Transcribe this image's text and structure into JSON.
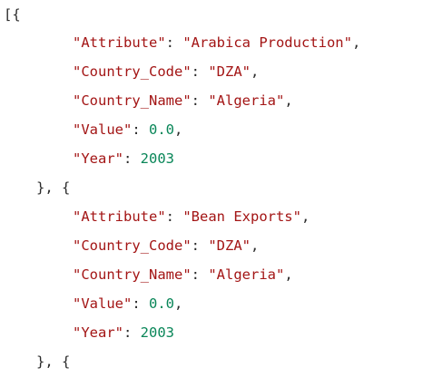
{
  "open_bracket": "[{",
  "separator": "}, {",
  "records": [
    {
      "attribute_key": "\"Attribute\"",
      "attribute_value": "\"Arabica Production\"",
      "country_code_key": "\"Country_Code\"",
      "country_code_value": "\"DZA\"",
      "country_name_key": "\"Country_Name\"",
      "country_name_value": "\"Algeria\"",
      "value_key": "\"Value\"",
      "value_value": "0.0",
      "year_key": "\"Year\"",
      "year_value": "2003"
    },
    {
      "attribute_key": "\"Attribute\"",
      "attribute_value": "\"Bean Exports\"",
      "country_code_key": "\"Country_Code\"",
      "country_code_value": "\"DZA\"",
      "country_name_key": "\"Country_Name\"",
      "country_name_value": "\"Algeria\"",
      "value_key": "\"Value\"",
      "value_value": "0.0",
      "year_key": "\"Year\"",
      "year_value": "2003"
    }
  ]
}
